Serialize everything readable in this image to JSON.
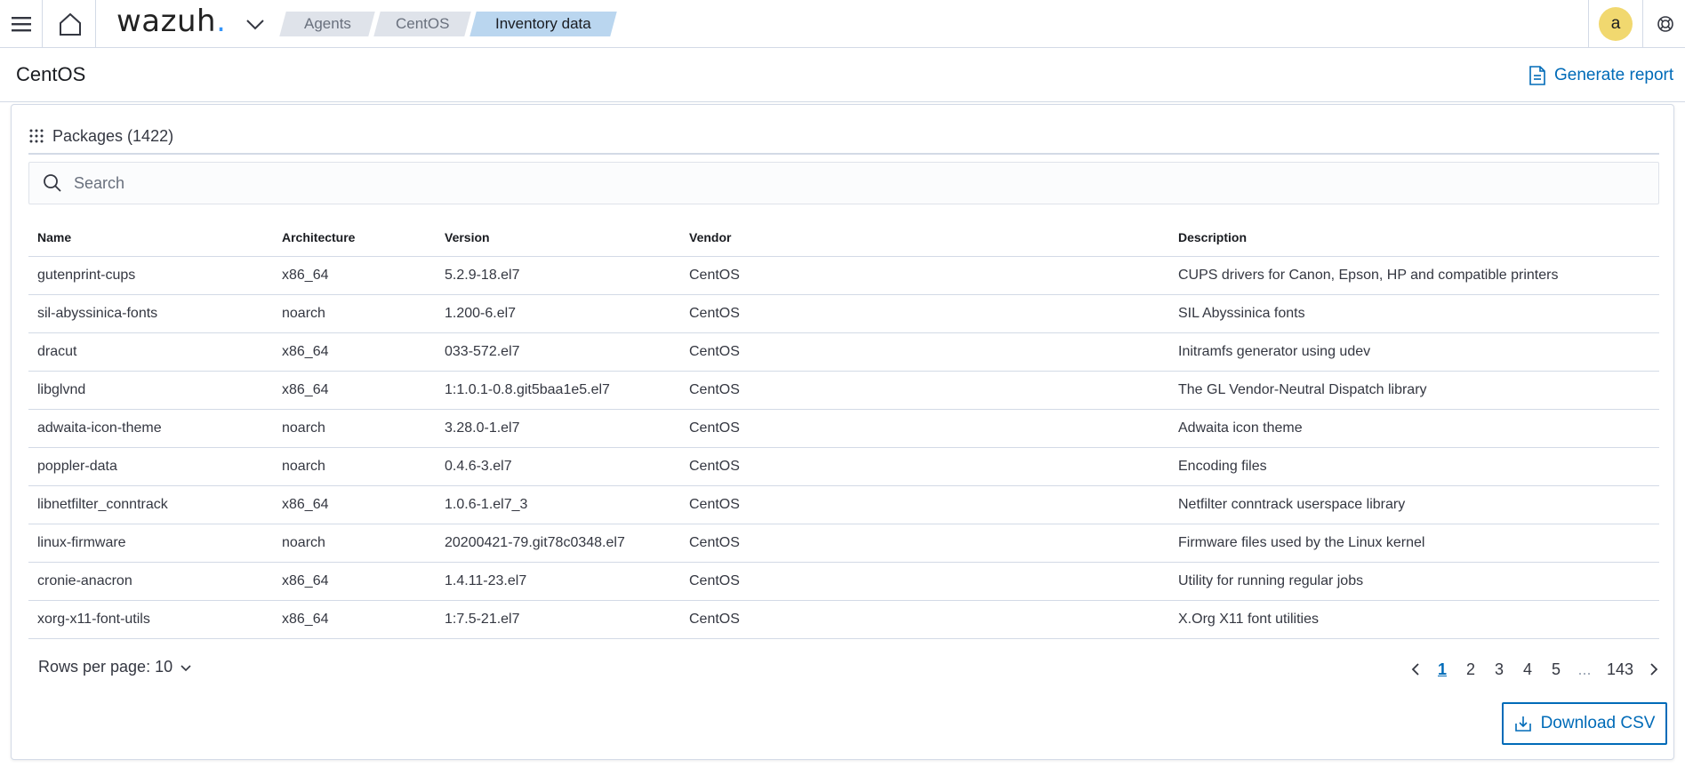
{
  "nav": {
    "logo_text": "wazuh",
    "logo_dot": ".",
    "breadcrumbs": [
      "Agents",
      "CentOS",
      "Inventory data"
    ],
    "avatar_initial": "a"
  },
  "header": {
    "title": "CentOS",
    "generate_report": "Generate report"
  },
  "panel": {
    "title": "Packages (1422)",
    "search_placeholder": "Search"
  },
  "table": {
    "columns": [
      "Name",
      "Architecture",
      "Version",
      "Vendor",
      "Description"
    ],
    "rows": [
      [
        "gutenprint-cups",
        "x86_64",
        "5.2.9-18.el7",
        "CentOS",
        "CUPS drivers for Canon, Epson, HP and compatible printers"
      ],
      [
        "sil-abyssinica-fonts",
        "noarch",
        "1.200-6.el7",
        "CentOS",
        "SIL Abyssinica fonts"
      ],
      [
        "dracut",
        "x86_64",
        "033-572.el7",
        "CentOS",
        "Initramfs generator using udev"
      ],
      [
        "libglvnd",
        "x86_64",
        "1:1.0.1-0.8.git5baa1e5.el7",
        "CentOS",
        "The GL Vendor-Neutral Dispatch library"
      ],
      [
        "adwaita-icon-theme",
        "noarch",
        "3.28.0-1.el7",
        "CentOS",
        "Adwaita icon theme"
      ],
      [
        "poppler-data",
        "noarch",
        "0.4.6-3.el7",
        "CentOS",
        "Encoding files"
      ],
      [
        "libnetfilter_conntrack",
        "x86_64",
        "1.0.6-1.el7_3",
        "CentOS",
        "Netfilter conntrack userspace library"
      ],
      [
        "linux-firmware",
        "noarch",
        "20200421-79.git78c0348.el7",
        "CentOS",
        "Firmware files used by the Linux kernel"
      ],
      [
        "cronie-anacron",
        "x86_64",
        "1.4.11-23.el7",
        "CentOS",
        "Utility for running regular jobs"
      ],
      [
        "xorg-x11-font-utils",
        "x86_64",
        "1:7.5-21.el7",
        "CentOS",
        "X.Org X11 font utilities"
      ]
    ]
  },
  "footer": {
    "rows_per_page": "Rows per page: 10",
    "pages": [
      "1",
      "2",
      "3",
      "4",
      "5",
      "...",
      "143"
    ],
    "current_page": "1",
    "download_csv": "Download CSV"
  },
  "colors": {
    "accent": "#006bb8",
    "breadcrumb_active": "#bad6ef",
    "breadcrumb": "#dfe3ea",
    "avatar": "#f1d86f",
    "logo_dot": "#3595f9"
  }
}
